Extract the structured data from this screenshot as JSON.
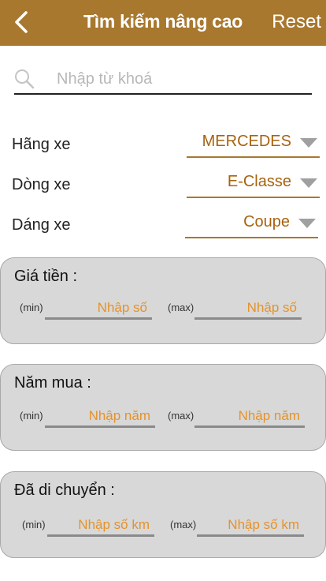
{
  "header": {
    "title": "Tìm kiếm nâng cao",
    "reset_label": "Reset",
    "background_color": "#a8782f"
  },
  "search": {
    "placeholder": "Nhập từ khoá",
    "value": ""
  },
  "filters": {
    "brand": {
      "label": "Hãng xe",
      "value": "MERCEDES"
    },
    "model": {
      "label": "Dòng xe",
      "value": "E-Classe"
    },
    "body_type": {
      "label": "Dáng xe",
      "value": "Coupe"
    }
  },
  "ranges": {
    "price": {
      "title": "Giá tiền :",
      "min_tag": "(min)",
      "max_tag": "(max)",
      "min_placeholder": "Nhập số",
      "max_placeholder": "Nhập số"
    },
    "year": {
      "title": "Năm mua :",
      "min_tag": "(min)",
      "max_tag": "(max)",
      "min_placeholder": "Nhập năm",
      "max_placeholder": "Nhập năm"
    },
    "mileage": {
      "title": "Đã di chuyển :",
      "min_tag": "(min)",
      "max_tag": "(max)",
      "min_placeholder": "Nhập số km",
      "max_placeholder": "Nhập số km"
    }
  },
  "colors": {
    "accent": "#a8620e",
    "placeholder_orange": "#e5922a",
    "range_box_bg": "#d8d8d8"
  }
}
